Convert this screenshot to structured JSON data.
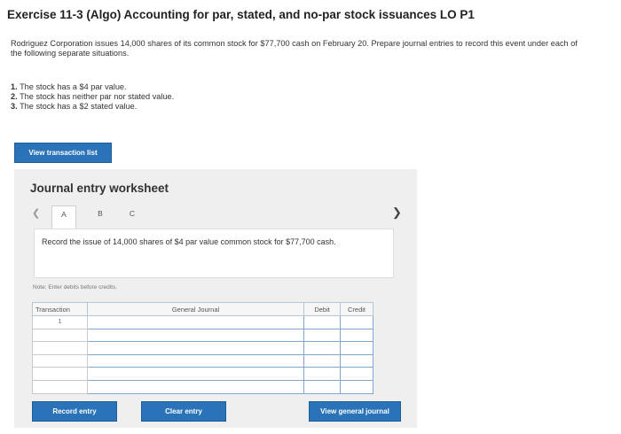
{
  "header": {
    "title": "Exercise 11-3 (Algo) Accounting for par, stated, and no-par stock issuances LO P1"
  },
  "intro": "Rodriguez Corporation issues 14,000 shares of its common stock for $77,700 cash on February 20. Prepare journal entries to record this event under each of the following separate situations.",
  "requirements": [
    {
      "num": "1.",
      "text": "The stock has a $4 par value."
    },
    {
      "num": "2.",
      "text": "The stock has neither par nor stated value."
    },
    {
      "num": "3.",
      "text": "The stock has a $2 stated value."
    }
  ],
  "view_transaction_label": "View transaction list",
  "worksheet": {
    "title": "Journal entry worksheet",
    "tabs": [
      "A",
      "B",
      "C"
    ],
    "prompt": "Record the issue of 14,000 shares of $4 par value common stock for $77,700 cash.",
    "note": "Note: Enter debits before credits.",
    "table": {
      "headers": [
        "Transaction",
        "General Journal",
        "Debit",
        "Credit"
      ],
      "first_transaction": "1"
    },
    "buttons": {
      "record": "Record entry",
      "clear": "Clear entry",
      "view_general": "View general journal"
    }
  },
  "colors": {
    "button_blue": "#2a73b8",
    "worksheet_bg": "#efefef",
    "input_border": "#7fa7cf"
  }
}
